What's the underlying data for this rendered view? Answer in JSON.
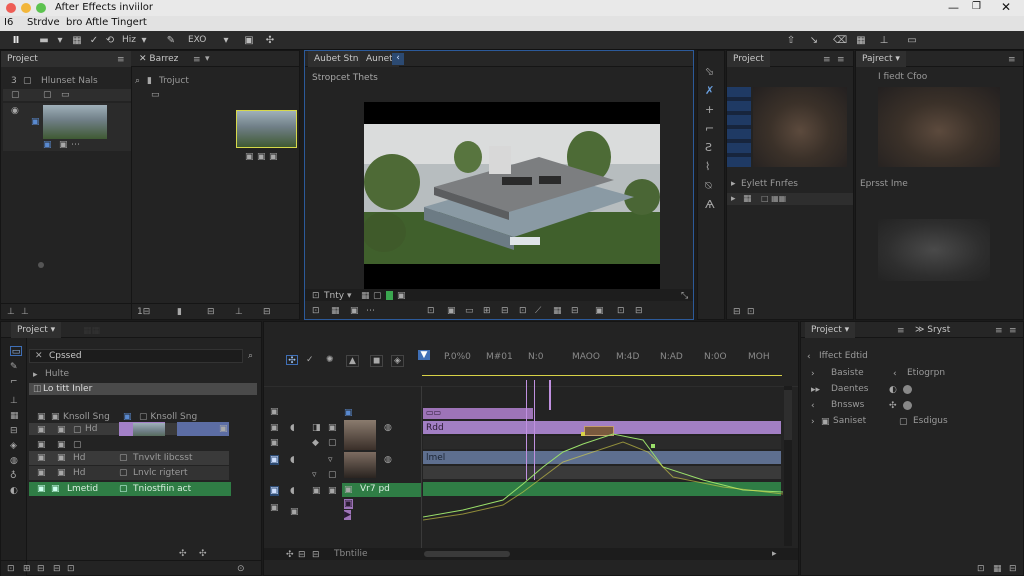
{
  "window": {
    "title": "After Effects inviilor"
  },
  "menu": [
    "I6",
    "Strdve",
    "bro Aftle Tingert"
  ],
  "toolbar": {
    "field1": "Hiz",
    "field2": "EXO"
  },
  "project_panel": {
    "tab_project": "Project",
    "tab_second": "Barrez",
    "row_label": "Hlunset Nals",
    "folder_label": "Trojuct"
  },
  "composition": {
    "tab1": "Aubet Stn",
    "tab2": "Aunet",
    "header": "Stropcet Thets",
    "zoom": "Tnty"
  },
  "right_top": {
    "tab_project": "Project",
    "tab_project2": "Pajrect",
    "right_label": "I fiedt Cfoo",
    "effects_row": "Eylett Fnrfes",
    "effect_label": "Eprsst Ime"
  },
  "timeline": {
    "project_tab": "Project",
    "comp_name": "Cpssed",
    "sub_label": "Hulte",
    "column_headers": "Lo titt Inler",
    "layers": [
      {
        "name": "Knsoll Sng",
        "source": ""
      },
      {
        "name": "Hd",
        "source": ""
      },
      {
        "name": "Hd",
        "source": "Tnvvlt Iibcsst"
      },
      {
        "name": "Hd",
        "source": "Lnvlc rigtert"
      },
      {
        "name": "Lmetid",
        "source": "Tniostfiin act"
      }
    ],
    "clip_labels": [
      "Rdd",
      "lmel"
    ],
    "green_label": "Vr7 pd",
    "time_markers": [
      "P.0%0",
      "M#01",
      "N:0",
      "MAOO",
      "M:4D",
      "N:AD",
      "N:0O",
      "MOH"
    ],
    "footer_label": "Tbntilie"
  },
  "effects_panel": {
    "tab1": "Project",
    "tab2": "Sryst",
    "header": "Iffect Edtid",
    "rows": [
      {
        "name": "Basiste",
        "value": "Etiogrpn"
      },
      {
        "name": "Daentes",
        "value": ""
      },
      {
        "name": "Bnssws",
        "value": ""
      },
      {
        "name": "Saniset",
        "value": "Esdigus"
      }
    ]
  },
  "colors": {
    "accent_blue": "#3f6fb6",
    "clip_purple": "#9e74b8",
    "clip_green": "#2f7d45",
    "clip_slate": "#5e6f8f",
    "graph_yellow": "#d8d247"
  }
}
